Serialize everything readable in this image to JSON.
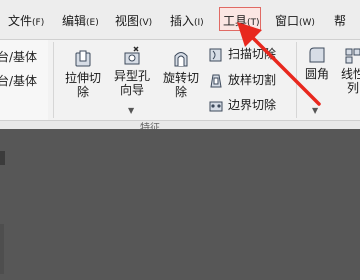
{
  "menubar": {
    "items": [
      {
        "label": "文件",
        "key": "(F)"
      },
      {
        "label": "编辑",
        "key": "(E)"
      },
      {
        "label": "视图",
        "key": "(V)"
      },
      {
        "label": "插入",
        "key": "(I)"
      },
      {
        "label": "工具",
        "key": "(T)"
      },
      {
        "label": "窗口",
        "key": "(W)"
      },
      {
        "label": "帮",
        "key": ""
      }
    ]
  },
  "ribbon": {
    "left_entries": [
      "台/基体",
      "台/基体"
    ],
    "buttons": [
      {
        "label_line1": "拉伸切",
        "label_line2": "除",
        "icon": "extrude-cut-icon"
      },
      {
        "label_line1": "异型孔",
        "label_line2": "向导",
        "icon": "hole-wizard-icon"
      },
      {
        "label_line1": "旋转切",
        "label_line2": "除",
        "icon": "revolve-cut-icon"
      }
    ],
    "small_commands": [
      {
        "label": "扫描切除",
        "icon": "swept-cut-icon"
      },
      {
        "label": "放样切割",
        "icon": "loft-cut-icon"
      },
      {
        "label": "边界切除",
        "icon": "boundary-cut-icon"
      }
    ],
    "fillet": {
      "label": "圆角",
      "icon": "fillet-icon"
    },
    "linear_pattern": {
      "label_line1": "线性",
      "label_line2": "列",
      "icon": "linear-pattern-icon"
    },
    "tab_partial": "特征"
  },
  "colors": {
    "arrow": "#e8281e",
    "canvas": "#575757",
    "menubar": "#ededed"
  }
}
